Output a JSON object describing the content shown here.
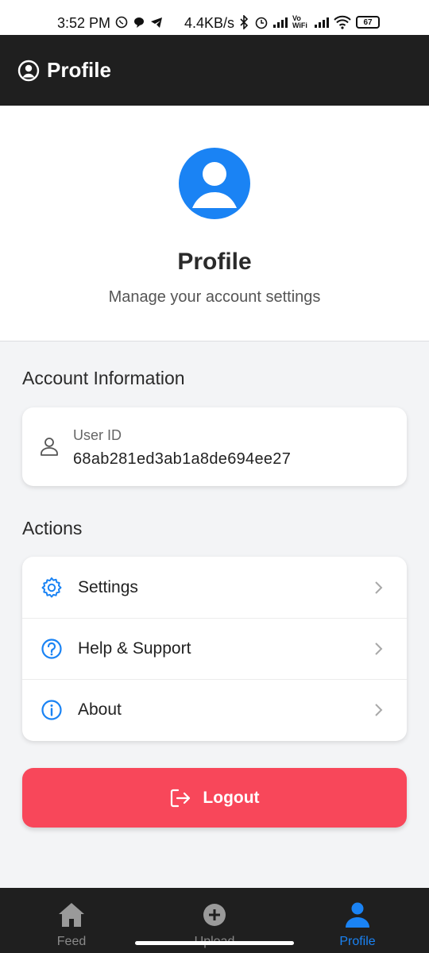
{
  "status_bar": {
    "time": "3:52 PM",
    "net_speed": "4.4KB/s",
    "vowifi": "Vo WiFi",
    "battery": "67"
  },
  "header": {
    "title": "Profile",
    "icon": "account-circle-icon"
  },
  "hero": {
    "title": "Profile",
    "subtitle": "Manage your account settings",
    "avatar_color": "#1a83f4"
  },
  "account": {
    "section_title": "Account Information",
    "user_id_label": "User ID",
    "user_id_value": "68ab281ed3ab1a8de694ee27"
  },
  "actions": {
    "section_title": "Actions",
    "items": [
      {
        "label": "Settings",
        "icon": "gear-icon"
      },
      {
        "label": "Help & Support",
        "icon": "help-circle-icon"
      },
      {
        "label": "About",
        "icon": "info-icon"
      }
    ]
  },
  "logout": {
    "label": "Logout",
    "color": "#f8475a"
  },
  "bottom_nav": {
    "items": [
      {
        "label": "Feed",
        "icon": "home-icon"
      },
      {
        "label": "Upload",
        "icon": "add-circle-icon"
      },
      {
        "label": "Profile",
        "icon": "person-icon",
        "active": true
      }
    ],
    "active_color": "#1a83f4"
  }
}
